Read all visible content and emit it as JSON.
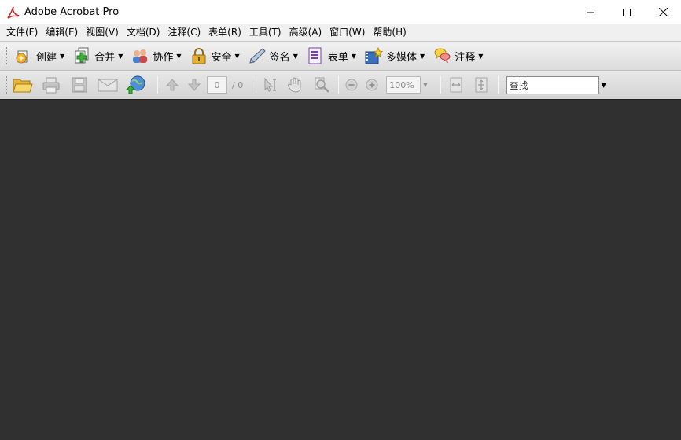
{
  "window": {
    "title": "Adobe Acrobat Pro",
    "controls": {
      "minimize": "—",
      "maximize": "☐",
      "close": "✕"
    }
  },
  "menu": [
    {
      "label": "文件(F)"
    },
    {
      "label": "编辑(E)"
    },
    {
      "label": "视图(V)"
    },
    {
      "label": "文档(D)"
    },
    {
      "label": "注释(C)"
    },
    {
      "label": "表单(R)"
    },
    {
      "label": "工具(T)"
    },
    {
      "label": "高级(A)"
    },
    {
      "label": "窗口(W)"
    },
    {
      "label": "帮助(H)"
    }
  ],
  "tasks_toolbar": [
    {
      "label": "创建",
      "icon": "create-icon"
    },
    {
      "label": "合并",
      "icon": "combine-icon"
    },
    {
      "label": "协作",
      "icon": "collaborate-icon"
    },
    {
      "label": "安全",
      "icon": "lock-icon"
    },
    {
      "label": "签名",
      "icon": "pen-icon"
    },
    {
      "label": "表单",
      "icon": "form-icon"
    },
    {
      "label": "多媒体",
      "icon": "multimedia-icon"
    },
    {
      "label": "注释",
      "icon": "comment-icon"
    }
  ],
  "file_toolbar": {
    "page_current": "0",
    "page_total": "/ 0",
    "zoom": "100%",
    "find_placeholder": "查找"
  },
  "colors": {
    "document_background": "#303030",
    "toolbar": "#e0e0e0",
    "accent_red": "#c8201e"
  }
}
